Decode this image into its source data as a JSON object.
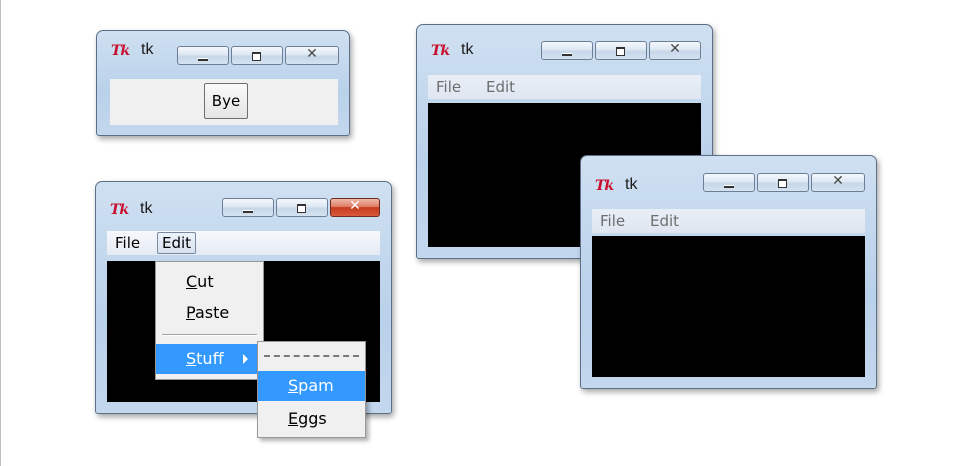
{
  "windows": {
    "bye_window": {
      "logo": "Tk",
      "title": "tk",
      "button_label": "Bye"
    },
    "menu_window": {
      "logo": "Tk",
      "title": "tk",
      "menu": [
        "File",
        "Edit"
      ],
      "edit_menu": {
        "items": [
          {
            "label": "Cut",
            "underline": "C",
            "rest": "ut"
          },
          {
            "label": "Paste",
            "underline": "P",
            "rest": "aste"
          },
          {
            "label": "Stuff",
            "underline": "S",
            "rest": "tuff"
          }
        ]
      },
      "stuff_submenu": {
        "items": [
          {
            "label": "Spam",
            "underline": "S",
            "rest": "pam"
          },
          {
            "label": "Eggs",
            "underline": "E",
            "rest": "ggs"
          }
        ]
      }
    },
    "top_right_window": {
      "logo": "Tk",
      "title": "tk",
      "menu": [
        "File",
        "Edit"
      ]
    },
    "bottom_right_window": {
      "logo": "Tk",
      "title": "tk",
      "menu": [
        "File",
        "Edit"
      ]
    }
  },
  "colors": {
    "highlight": "#3399ff",
    "canvas": "#000000",
    "close_button_active": "#c63b1d"
  },
  "icons": {
    "titlebar": [
      "minimize-icon",
      "maximize-icon",
      "close-icon"
    ],
    "logo": "tk-feather-logo"
  }
}
